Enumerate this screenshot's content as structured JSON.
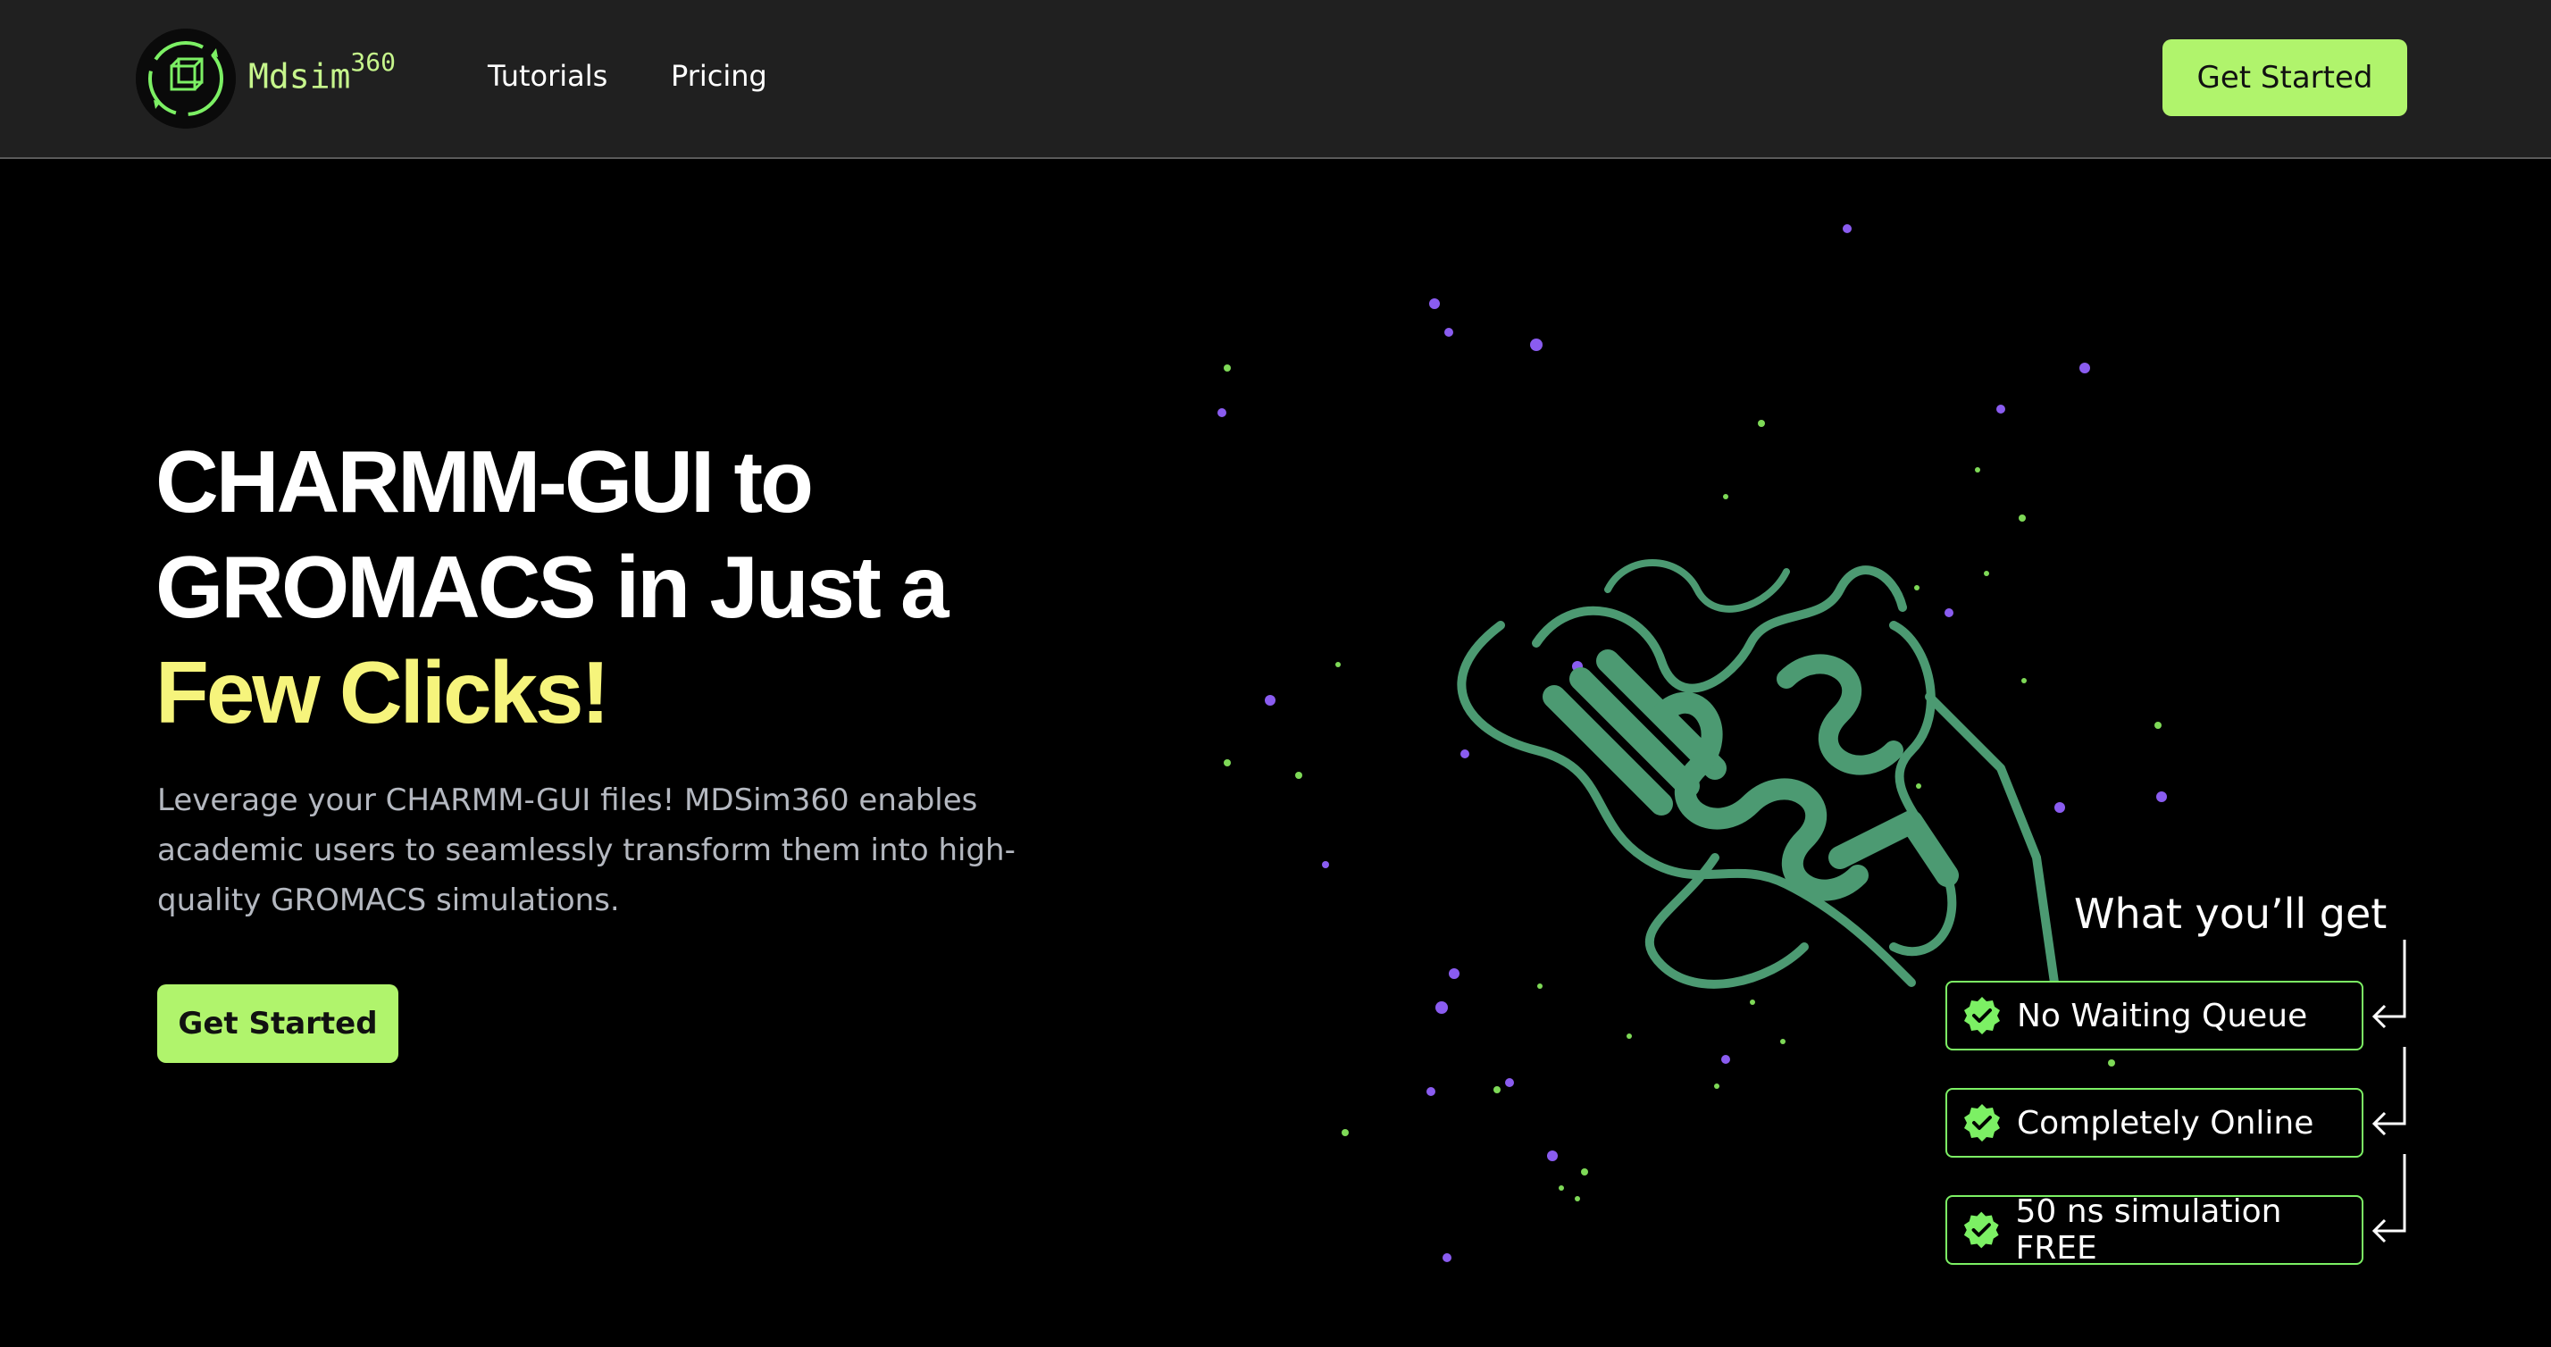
{
  "nav": {
    "logo_text": "Mdsim",
    "logo_sup": "360",
    "links": [
      "Tutorials",
      "Pricing"
    ],
    "cta": "Get Started"
  },
  "hero": {
    "title_line1": "CHARMM-GUI to",
    "title_line2": "GROMACS in Just a",
    "title_line3": "Few Clicks!",
    "description": "Leverage your CHARMM-GUI files! MDSim360 enables academic users to seamlessly transform them into high-quality GROMACS simulations.",
    "cta": "Get Started"
  },
  "features": {
    "heading": "What you’ll get",
    "items": [
      {
        "label": "No Waiting Queue",
        "icon": "check-badge-icon"
      },
      {
        "label": "Completely Online",
        "icon": "check-badge-icon"
      },
      {
        "label": "50 ns simulation FREE",
        "icon": "check-badge-icon"
      }
    ]
  },
  "colors": {
    "accent_green": "#b0f46c",
    "accent_yellow": "#f6f47c",
    "protein": "#4c9a72",
    "particle_purple": "#8a5cf0",
    "particle_green": "#7ed957"
  }
}
